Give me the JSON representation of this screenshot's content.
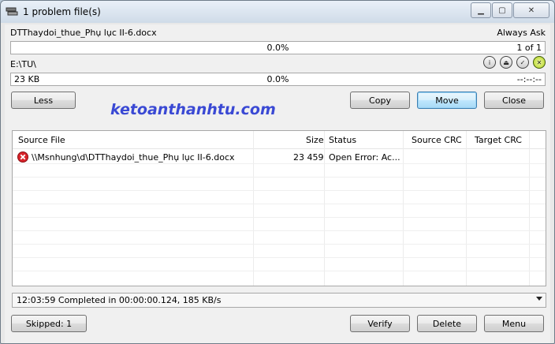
{
  "window": {
    "title": "1 problem file(s)"
  },
  "source": {
    "file_name": "DTThaydoi_thue_Phụ lục II-6.docx",
    "mode": "Always Ask",
    "progress_text": "0.0%",
    "count_text": "1 of 1"
  },
  "target": {
    "path": "E:\\TU\\",
    "size_text": "23 KB",
    "progress_text": "0.0%",
    "time_text": "--:--:--"
  },
  "buttons": {
    "less": "Less",
    "copy": "Copy",
    "move": "Move",
    "close": "Close",
    "skipped": "Skipped: 1",
    "verify": "Verify",
    "delete": "Delete",
    "menu": "Menu"
  },
  "watermark": "ketoanthanhtu.com",
  "table": {
    "columns": [
      "Source File",
      "Size",
      "Status",
      "Source CRC",
      "Target CRC"
    ],
    "rows": [
      {
        "source_file": "\\\\Msnhung\\d\\DTThaydoi_thue_Phụ lục II-6.docx",
        "size": "23 459",
        "status": "Open Error: Ac...",
        "source_crc": "",
        "target_crc": ""
      }
    ]
  },
  "status_combo": "12:03:59 Completed in 00:00:00.124, 185 KB/s",
  "icons": [
    "app-icon",
    "info-icon",
    "eject-icon",
    "check-icon",
    "close-circle-icon",
    "error-icon",
    "dropdown-arrow-icon"
  ]
}
